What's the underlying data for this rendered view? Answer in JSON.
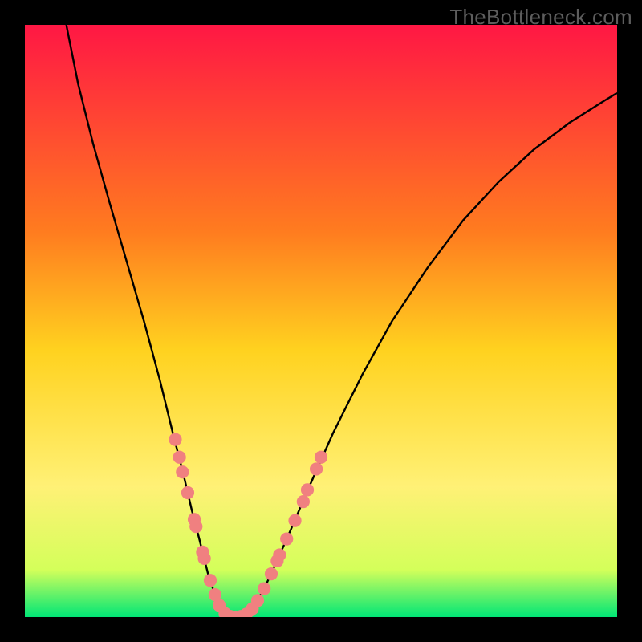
{
  "watermark": "TheBottleneck.com",
  "chart_data": {
    "type": "line",
    "title": "",
    "xlabel": "",
    "ylabel": "",
    "xlim": [
      0,
      100
    ],
    "ylim": [
      0,
      100
    ],
    "grid": false,
    "legend": false,
    "gradient_stops": [
      {
        "offset": 0,
        "color": "#ff1744"
      },
      {
        "offset": 35,
        "color": "#ff7c1f"
      },
      {
        "offset": 55,
        "color": "#ffd21f"
      },
      {
        "offset": 78,
        "color": "#fff176"
      },
      {
        "offset": 92,
        "color": "#d4ff5a"
      },
      {
        "offset": 100,
        "color": "#00e676"
      }
    ],
    "series": [
      {
        "name": "bottleneck-curve",
        "stroke": "#000000",
        "points": [
          {
            "x": 7.0,
            "y": 100.0
          },
          {
            "x": 9.0,
            "y": 90.0
          },
          {
            "x": 11.5,
            "y": 80.0
          },
          {
            "x": 14.3,
            "y": 70.0
          },
          {
            "x": 17.2,
            "y": 60.0
          },
          {
            "x": 20.1,
            "y": 50.0
          },
          {
            "x": 22.8,
            "y": 40.0
          },
          {
            "x": 25.0,
            "y": 31.0
          },
          {
            "x": 26.8,
            "y": 24.0
          },
          {
            "x": 28.2,
            "y": 18.0
          },
          {
            "x": 29.5,
            "y": 13.0
          },
          {
            "x": 31.0,
            "y": 7.0
          },
          {
            "x": 32.2,
            "y": 3.5
          },
          {
            "x": 33.2,
            "y": 1.5
          },
          {
            "x": 34.4,
            "y": 0.2
          },
          {
            "x": 35.8,
            "y": 0.0
          },
          {
            "x": 37.4,
            "y": 0.5
          },
          {
            "x": 38.8,
            "y": 2.0
          },
          {
            "x": 40.5,
            "y": 5.0
          },
          {
            "x": 42.8,
            "y": 10.0
          },
          {
            "x": 45.0,
            "y": 15.0
          },
          {
            "x": 48.0,
            "y": 22.0
          },
          {
            "x": 52.0,
            "y": 31.0
          },
          {
            "x": 57.0,
            "y": 41.0
          },
          {
            "x": 62.0,
            "y": 50.0
          },
          {
            "x": 68.0,
            "y": 59.0
          },
          {
            "x": 74.0,
            "y": 67.0
          },
          {
            "x": 80.0,
            "y": 73.5
          },
          {
            "x": 86.0,
            "y": 79.0
          },
          {
            "x": 92.0,
            "y": 83.5
          },
          {
            "x": 98.0,
            "y": 87.3
          },
          {
            "x": 100.0,
            "y": 88.5
          }
        ]
      }
    ],
    "markers": {
      "color": "#f08080",
      "radius": 1.1,
      "points": [
        {
          "x": 25.4,
          "y": 30.0
        },
        {
          "x": 26.1,
          "y": 27.0
        },
        {
          "x": 26.6,
          "y": 24.5
        },
        {
          "x": 27.5,
          "y": 21.0
        },
        {
          "x": 28.6,
          "y": 16.5
        },
        {
          "x": 28.9,
          "y": 15.3
        },
        {
          "x": 30.0,
          "y": 11.0
        },
        {
          "x": 30.3,
          "y": 9.9
        },
        {
          "x": 31.3,
          "y": 6.2
        },
        {
          "x": 32.1,
          "y": 3.8
        },
        {
          "x": 32.8,
          "y": 2.0
        },
        {
          "x": 33.8,
          "y": 0.6
        },
        {
          "x": 34.7,
          "y": 0.1
        },
        {
          "x": 35.6,
          "y": 0.0
        },
        {
          "x": 36.5,
          "y": 0.1
        },
        {
          "x": 37.4,
          "y": 0.5
        },
        {
          "x": 38.4,
          "y": 1.4
        },
        {
          "x": 39.3,
          "y": 2.8
        },
        {
          "x": 40.4,
          "y": 4.8
        },
        {
          "x": 41.6,
          "y": 7.3
        },
        {
          "x": 42.6,
          "y": 9.5
        },
        {
          "x": 43.0,
          "y": 10.5
        },
        {
          "x": 44.2,
          "y": 13.2
        },
        {
          "x": 45.6,
          "y": 16.3
        },
        {
          "x": 47.0,
          "y": 19.5
        },
        {
          "x": 47.7,
          "y": 21.5
        },
        {
          "x": 49.2,
          "y": 25.0
        },
        {
          "x": 50.0,
          "y": 27.0
        }
      ]
    }
  }
}
